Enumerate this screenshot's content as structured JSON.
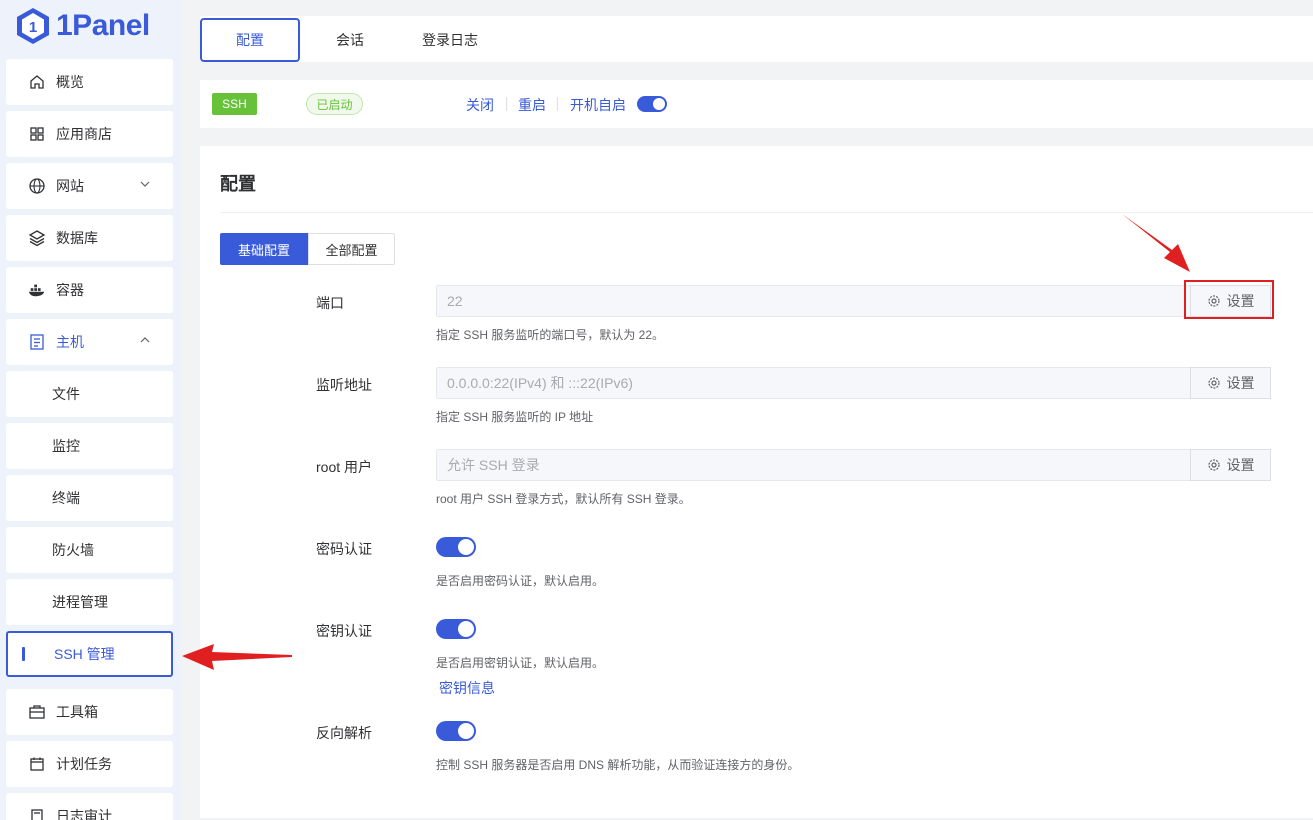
{
  "app": {
    "logo_text": "1Panel"
  },
  "sidebar": {
    "items": [
      {
        "label": "概览",
        "icon": "home-icon"
      },
      {
        "label": "应用商店",
        "icon": "grid-icon"
      },
      {
        "label": "网站",
        "icon": "globe-icon"
      },
      {
        "label": "数据库",
        "icon": "layers-icon"
      },
      {
        "label": "容器",
        "icon": "docker-icon"
      },
      {
        "label": "主机",
        "icon": "host-icon"
      },
      {
        "label": "文件"
      },
      {
        "label": "监控"
      },
      {
        "label": "终端"
      },
      {
        "label": "防火墙"
      },
      {
        "label": "进程管理"
      },
      {
        "label": "SSH 管理"
      },
      {
        "label": "工具箱",
        "icon": "toolbox-icon"
      },
      {
        "label": "计划任务",
        "icon": "calendar-icon"
      },
      {
        "label": "日志审计",
        "icon": "log-icon"
      }
    ]
  },
  "tabs": [
    {
      "label": "配置"
    },
    {
      "label": "会话"
    },
    {
      "label": "登录日志"
    }
  ],
  "status": {
    "service_tag": "SSH",
    "state": "已启动",
    "stop": "关闭",
    "restart": "重启",
    "autostart": "开机自启",
    "autostart_on": true
  },
  "config": {
    "title": "配置",
    "seg_basic": "基础配置",
    "seg_all": "全部配置",
    "set_label": "设置",
    "port": {
      "label": "端口",
      "value": "22",
      "hint": "指定 SSH 服务监听的端口号，默认为 22。"
    },
    "listen": {
      "label": "监听地址",
      "value": "0.0.0.0:22(IPv4) 和 :::22(IPv6)",
      "hint": "指定 SSH 服务监听的 IP 地址"
    },
    "root": {
      "label": "root 用户",
      "value": "允许 SSH 登录",
      "hint": "root 用户 SSH 登录方式，默认所有 SSH 登录。"
    },
    "password": {
      "label": "密码认证",
      "hint": "是否启用密码认证，默认启用。",
      "on": true
    },
    "key": {
      "label": "密钥认证",
      "hint": "是否启用密钥认证，默认启用。",
      "link": "密钥信息",
      "on": true
    },
    "dns": {
      "label": "反向解析",
      "hint": "控制 SSH 服务器是否启用 DNS 解析功能，从而验证连接方的身份。",
      "on": true
    }
  },
  "colors": {
    "primary": "#3a5bd9",
    "success": "#67c23a",
    "annotation": "#e02020"
  }
}
